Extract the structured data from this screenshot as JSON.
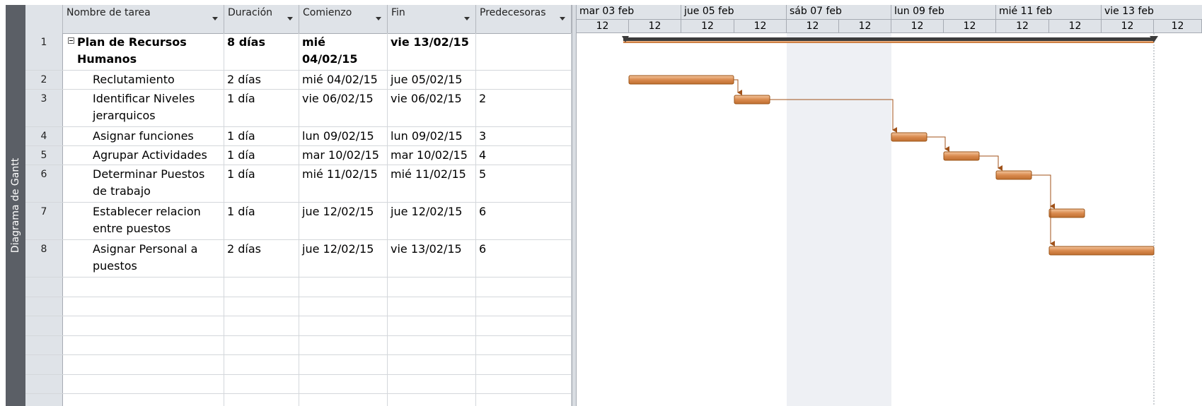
{
  "view": {
    "label": "Diagrama de Gantt"
  },
  "table": {
    "columns": [
      {
        "key": "name",
        "label": "Nombre de tarea"
      },
      {
        "key": "duration",
        "label": "Duración"
      },
      {
        "key": "start",
        "label": "Comienzo"
      },
      {
        "key": "finish",
        "label": "Fin"
      },
      {
        "key": "pred",
        "label": "Predecesoras"
      }
    ],
    "rows": [
      {
        "id": "1",
        "name": "Plan de Recursos Humanos",
        "duration": "8 días",
        "start": "mié 04/02/15",
        "finish": "vie 13/02/15",
        "pred": "",
        "summary": true
      },
      {
        "id": "2",
        "name": "Reclutamiento",
        "duration": "2 días",
        "start": "mié 04/02/15",
        "finish": "jue 05/02/15",
        "pred": ""
      },
      {
        "id": "3",
        "name": "Identificar Niveles jerarquicos",
        "duration": "1 día",
        "start": "vie 06/02/15",
        "finish": "vie 06/02/15",
        "pred": "2"
      },
      {
        "id": "4",
        "name": "Asignar funciones",
        "duration": "1 día",
        "start": "lun 09/02/15",
        "finish": "lun 09/02/15",
        "pred": "3"
      },
      {
        "id": "5",
        "name": "Agrupar Actividades",
        "duration": "1 día",
        "start": "mar 10/02/15",
        "finish": "mar 10/02/15",
        "pred": "4"
      },
      {
        "id": "6",
        "name": "Determinar Puestos de trabajo",
        "duration": "1 día",
        "start": "mié 11/02/15",
        "finish": "mié 11/02/15",
        "pred": "5"
      },
      {
        "id": "7",
        "name": "Establecer relacion entre puestos",
        "duration": "1 día",
        "start": "jue 12/02/15",
        "finish": "jue 12/02/15",
        "pred": "6"
      },
      {
        "id": "8",
        "name": "Asignar Personal a puestos",
        "duration": "2 días",
        "start": "jue 12/02/15",
        "finish": "vie 13/02/15",
        "pred": "6"
      }
    ]
  },
  "timescale": {
    "major": [
      "mar 03 feb",
      "jue 05 feb",
      "sáb 07 feb",
      "lun 09 feb",
      "mié 11 feb",
      "vie 13 feb"
    ],
    "minor": [
      "12",
      "12",
      "12",
      "12",
      "12",
      "12",
      "12",
      "12",
      "12",
      "12",
      "12",
      "12",
      "12"
    ]
  },
  "colors": {
    "bar": "#d98a4e",
    "bar_border": "#9b5316",
    "link": "#a0521a",
    "summary": "#3c3c3c",
    "nonworking": "#eef0f4"
  }
}
